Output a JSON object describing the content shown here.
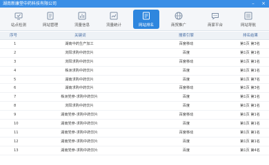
{
  "window": {
    "title": "湖南新康堂中药科技有限公司",
    "controls": {
      "minimize": "–",
      "close": "×"
    }
  },
  "toolbar": [
    {
      "label": "站点检测",
      "icon": "monitor-check-icon"
    },
    {
      "label": "网站管理",
      "icon": "document-icon"
    },
    {
      "label": "流量信息",
      "icon": "chart-bars-icon"
    },
    {
      "label": "流量统计",
      "icon": "statistics-icon"
    },
    {
      "label": "网站排名",
      "icon": "ranking-icon",
      "active": true
    },
    {
      "label": "商贸推广",
      "icon": "globe-icon"
    },
    {
      "label": "商家平台",
      "icon": "chat-icon"
    },
    {
      "label": "网站导航",
      "icon": "navigation-icon"
    }
  ],
  "table": {
    "headers": {
      "index": "序号",
      "keyword": "关键词",
      "engine": "搜索引擎",
      "rank": "排名结果"
    },
    "rows": [
      {
        "index": "1",
        "keyword": "湖南中药生产加工",
        "engine": "百度移动",
        "rank": "第1页 第3名"
      },
      {
        "index": "2",
        "keyword": "浏阳求购中药饮片",
        "engine": "百度",
        "rank": "第1页 第1名"
      },
      {
        "index": "3",
        "keyword": "浏阳求购中药饮片",
        "engine": "百度移动",
        "rank": "第1页 第1名"
      },
      {
        "index": "4",
        "keyword": "株洲求购中药饮片",
        "engine": "百度",
        "rank": "第1页 第1名"
      },
      {
        "index": "5",
        "keyword": "湖南求购中药饮片",
        "engine": "百度",
        "rank": "第1页 第7名"
      },
      {
        "index": "6",
        "keyword": "湖南求购中药饮片",
        "engine": "百度移动",
        "rank": "第1页 第3名"
      },
      {
        "index": "7",
        "keyword": "株洲党参-求购中药饮片",
        "engine": "百度",
        "rank": "第1页 第1名"
      },
      {
        "index": "8",
        "keyword": "浏阳求购中药饮片",
        "engine": "百度",
        "rank": "第1页 第1名"
      },
      {
        "index": "9",
        "keyword": "湖南党参-求购中药饮片",
        "engine": "百度移动",
        "rank": "第1页 第1名"
      },
      {
        "index": "10",
        "keyword": "湖南党参-求购中药饮片",
        "engine": "百度",
        "rank": "第1页 第1名"
      },
      {
        "index": "11",
        "keyword": "湖南党参-求购中药饮片",
        "engine": "百度移动",
        "rank": "第1页 第1名"
      },
      {
        "index": "12",
        "keyword": "湖南党参-求购中药饮片",
        "engine": "百度",
        "rank": "第1页 第1名"
      },
      {
        "index": "13",
        "keyword": "湖南党参-求购中药饮片",
        "engine": "百度",
        "rank": "第1页 第4名"
      }
    ]
  },
  "colors": {
    "accent": "#2e86de",
    "titlebar": "#3a8ee6",
    "header_text": "#4a6fa5"
  }
}
